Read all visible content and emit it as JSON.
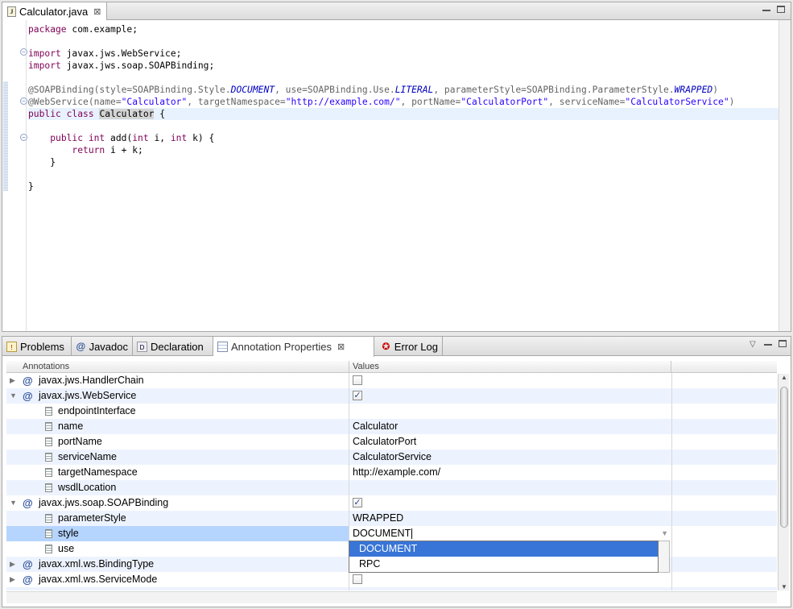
{
  "editor": {
    "tab_label": "Calculator.java",
    "tab_close": "⊠",
    "code": {
      "package_kw": "package",
      "package_name": " com.example;",
      "import_kw": "import",
      "import1": " javax.jws.WebService;",
      "import2": " javax.jws.soap.SOAPBinding;",
      "soap_a": "@SOAPBinding(style=SOAPBinding.Style.",
      "soap_b": "DOCUMENT",
      "soap_c": ", use=SOAPBinding.Use.",
      "soap_d": "LITERAL",
      "soap_e": ", parameterStyle=SOAPBinding.ParameterStyle.",
      "soap_f": "WRAPPED",
      "soap_g": ")",
      "ws_a": "@WebService(name=",
      "ws_b": "\"Calculator\"",
      "ws_c": ", targetNamespace=",
      "ws_d": "\"http://example.com/\"",
      "ws_e": ", portName=",
      "ws_f": "\"CalculatorPort\"",
      "ws_g": ", serviceName=",
      "ws_h": "\"CalculatorService\"",
      "ws_i": ")",
      "class_kw": "public class",
      "class_name": "Calculator",
      "class_brace": " {",
      "method_kw": "public int",
      "method_a": " add(",
      "method_int1": "int",
      "method_b": " i, ",
      "method_int2": "int",
      "method_c": " k) {",
      "return_kw": "return",
      "return_expr": " i + k;",
      "close1": "}",
      "close2": "}"
    }
  },
  "bottom": {
    "tabs": [
      {
        "label": "Problems"
      },
      {
        "label": "Javadoc"
      },
      {
        "label": "Declaration"
      },
      {
        "label": "Annotation Properties",
        "close": "⊠"
      },
      {
        "label": "Error Log"
      }
    ],
    "columns": {
      "annotations": "Annotations",
      "values": "Values"
    },
    "rows": [
      {
        "name": "javax.jws.HandlerChain",
        "checked": false
      },
      {
        "name": "javax.jws.WebService",
        "checked": true
      },
      {
        "name": "endpointInterface",
        "value": ""
      },
      {
        "name": "name",
        "value": "Calculator"
      },
      {
        "name": "portName",
        "value": "CalculatorPort"
      },
      {
        "name": "serviceName",
        "value": "CalculatorService"
      },
      {
        "name": "targetNamespace",
        "value": "http://example.com/"
      },
      {
        "name": "wsdlLocation",
        "value": ""
      },
      {
        "name": "javax.jws.soap.SOAPBinding",
        "checked": true
      },
      {
        "name": "parameterStyle",
        "value": "WRAPPED"
      },
      {
        "name": "style",
        "value": "DOCUMENT"
      },
      {
        "name": "use",
        "value": ""
      },
      {
        "name": "javax.xml.ws.BindingType"
      },
      {
        "name": "javax.xml.ws.ServiceMode",
        "checked": false
      }
    ],
    "dropdown_options": [
      "DOCUMENT",
      "RPC"
    ],
    "check_mark": "✓"
  },
  "colors": {
    "selection": "#3875d7",
    "alt_row": "#edf3fe",
    "keyword": "#7f0055",
    "string": "#2a00ff"
  }
}
